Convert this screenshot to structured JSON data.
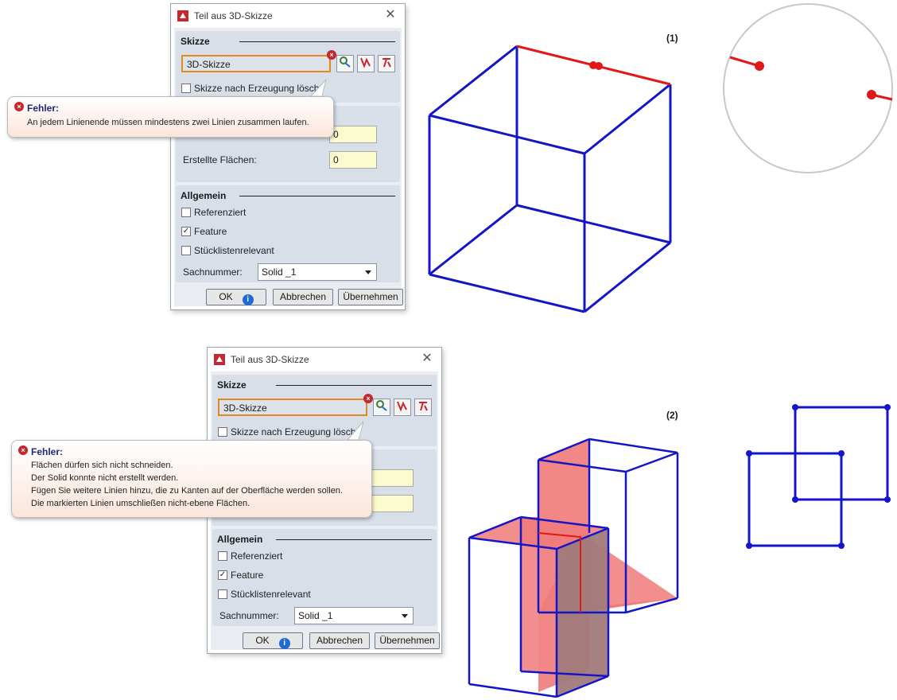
{
  "figure_labels": {
    "one": "(1)",
    "two": "(2)"
  },
  "dialog": {
    "title": "Teil aus 3D-Skizze",
    "skizze_header": "Skizze",
    "sketch_field_value": "3D-Skizze",
    "delete_after_label": "Skizze nach Erzeugung lösch",
    "created_faces_label": "Erstellte Flächen:",
    "created_faces_value": "0",
    "mid_value": "0",
    "allgemein_header": "Allgemein",
    "referenced_label": "Referenziert",
    "feature_label": "Feature",
    "bom_label": "Stücklistenrelevant",
    "part_number_label": "Sachnummer:",
    "part_number_value": "Solid _1",
    "ok_label": "OK",
    "cancel_label": "Abbrechen",
    "apply_label": "Übernehmen",
    "feature_checked": true,
    "referenced_checked": false,
    "bom_checked": false
  },
  "error1": {
    "title": "Fehler:",
    "lines": [
      "An jedem Linienende müssen mindestens zwei Linien zusammen laufen."
    ]
  },
  "error2": {
    "title": "Fehler:",
    "lines": [
      "Flächen dürfen sich nicht schneiden.",
      "Der Solid konnte nicht erstellt werden.",
      "Fügen Sie weitere Linien hinzu, die zu Kanten auf der Oberfläche werden sollen.",
      "Die markierten Linien umschließen nicht-ebene Flächen."
    ]
  },
  "colors": {
    "edge": "#1515c8",
    "error_edge": "#e01818",
    "face": "#f07a7a",
    "accent": "#e3881b"
  }
}
